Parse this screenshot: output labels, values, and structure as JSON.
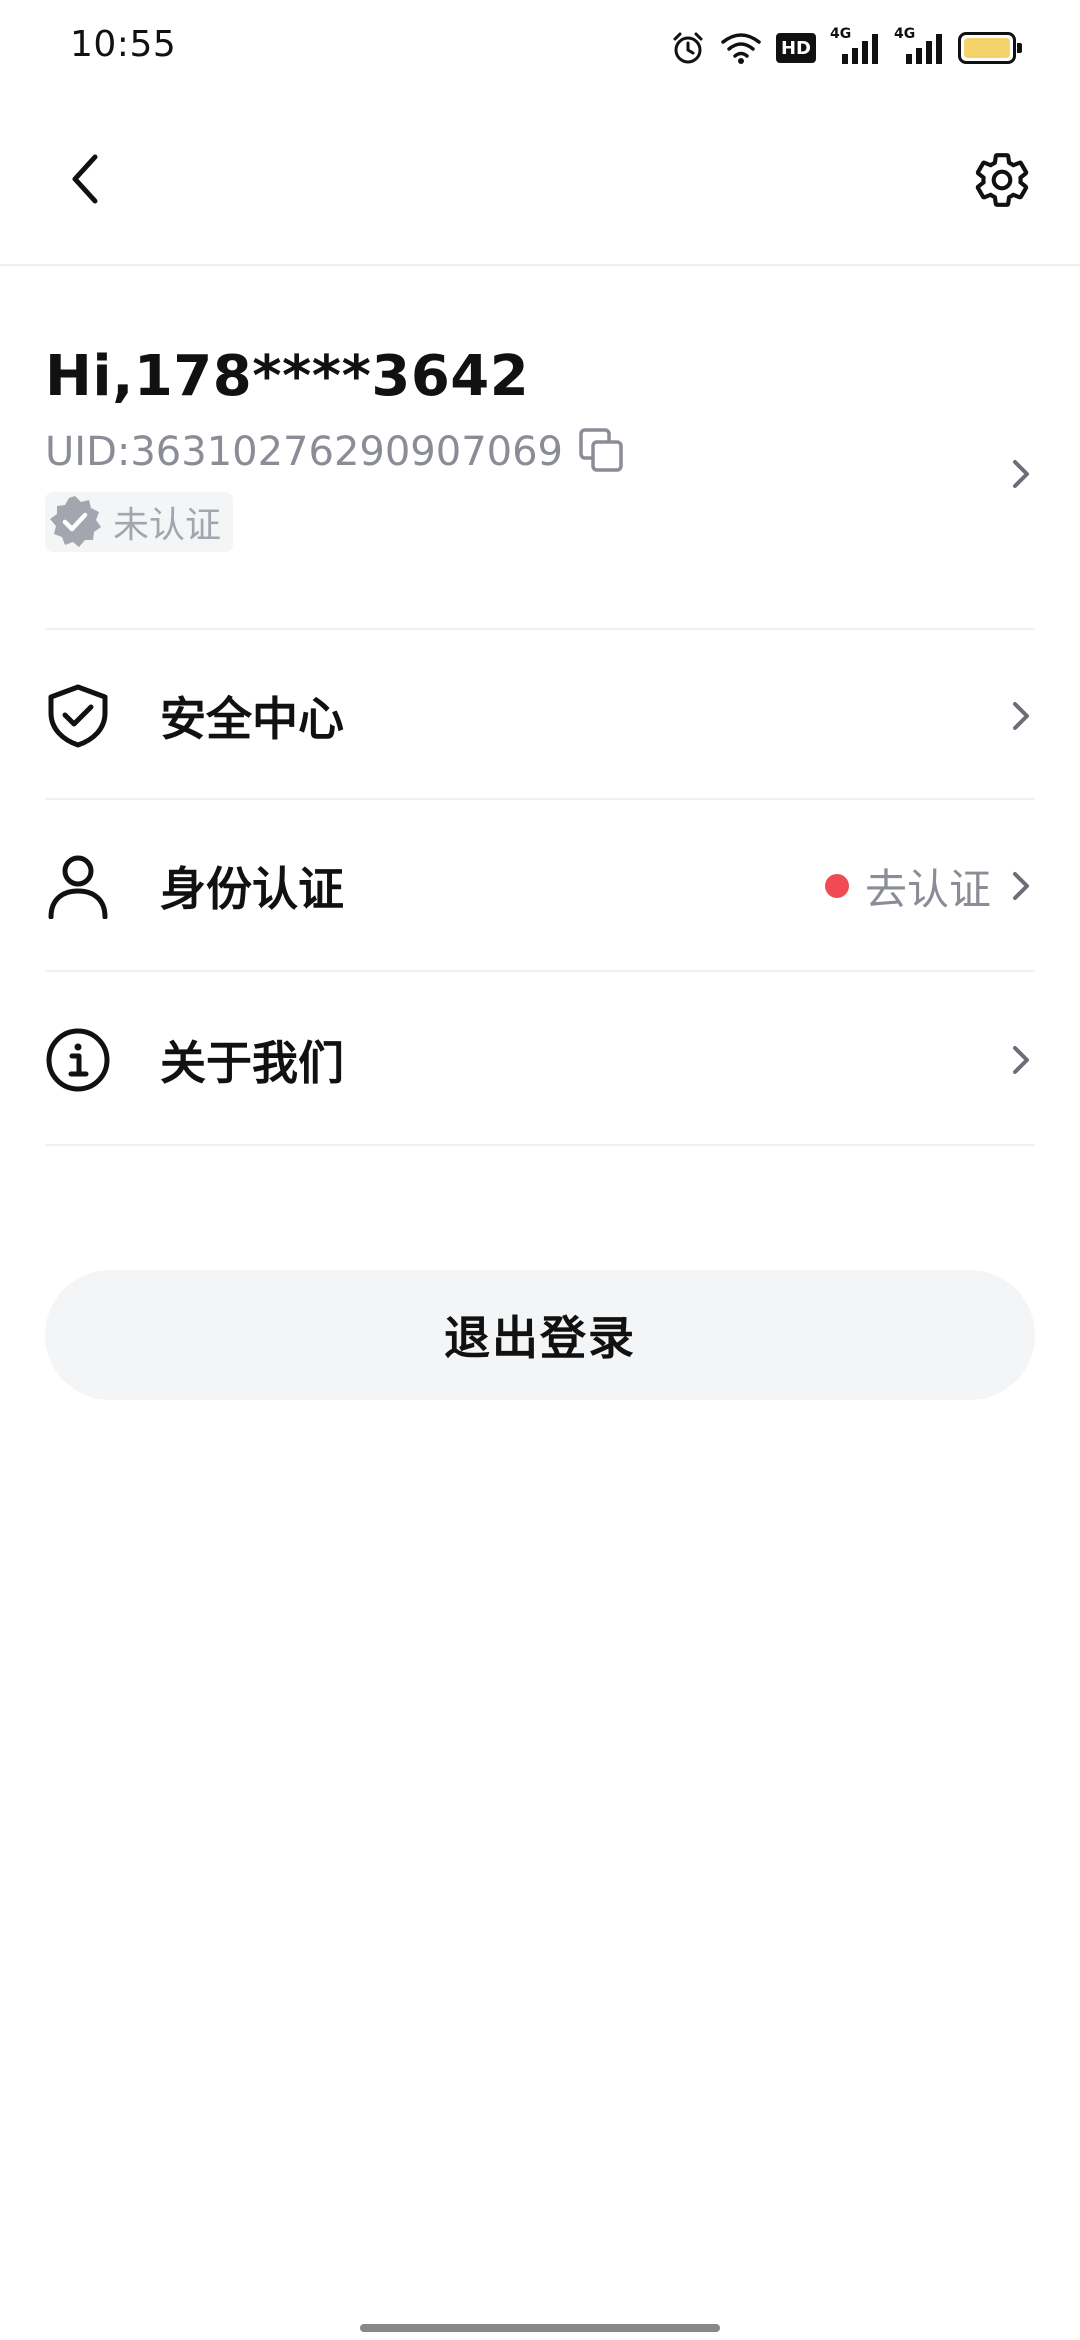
{
  "status_bar": {
    "time": "10:55",
    "hd_label": "HD",
    "signal1_label": "4G",
    "signal2_label": "4G",
    "battery_color": "#f5d36b"
  },
  "nav": {
    "back_icon": "chevron-left-icon",
    "settings_icon": "gear-icon"
  },
  "profile": {
    "greeting": "Hi,178****3642",
    "uid": "UID:36310276290907069",
    "verify_status": "未认证"
  },
  "menu": {
    "items": [
      {
        "label": "安全中心",
        "icon": "shield-check-icon"
      },
      {
        "label": "身份认证",
        "icon": "user-icon",
        "status": "去认证",
        "dot_color": "#f04b55"
      },
      {
        "label": "关于我们",
        "icon": "info-icon"
      }
    ]
  },
  "logout": {
    "label": "退出登录"
  },
  "colors": {
    "text_primary": "#111111",
    "text_secondary": "#8a8d96",
    "surface": "#f4f5f7",
    "alert_dot": "#f04b55"
  }
}
